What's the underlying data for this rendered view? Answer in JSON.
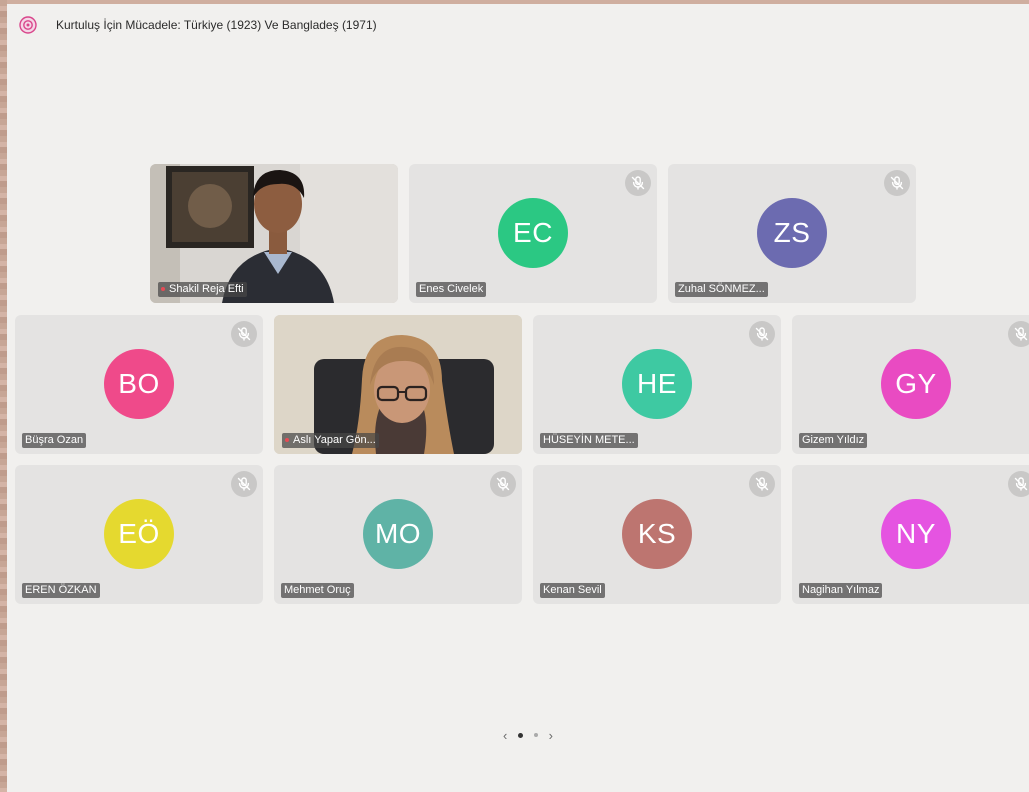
{
  "meeting": {
    "title": "Kurtuluş İçin Mücadele: Türkiye (1923) Ve Bangladeş (1971)",
    "logo_icon": "app-logo-icon"
  },
  "colors": {
    "window_bg": "#f1f0ee",
    "tile_bg": "#e4e3e2",
    "mute_icon": "mic-off-icon"
  },
  "participants": [
    {
      "name": "Shakil Reja Efti",
      "initials": "",
      "video": true,
      "muted": false,
      "color": ""
    },
    {
      "name": "Enes Civelek",
      "initials": "EC",
      "video": false,
      "muted": true,
      "color": "#2bc883"
    },
    {
      "name": "Zuhal SÖNMEZ...",
      "initials": "ZS",
      "video": false,
      "muted": true,
      "color": "#6c6bb0"
    },
    {
      "name": "Büşra Ozan",
      "initials": "BO",
      "video": false,
      "muted": true,
      "color": "#ef4a8a"
    },
    {
      "name": "Aslı Yapar Gön...",
      "initials": "",
      "video": true,
      "muted": false,
      "color": ""
    },
    {
      "name": "HÜSEYİN METE...",
      "initials": "HE",
      "video": false,
      "muted": true,
      "color": "#3ec9a2"
    },
    {
      "name": "Gizem Yıldız",
      "initials": "GY",
      "video": false,
      "muted": true,
      "color": "#e94bc2"
    },
    {
      "name": "EREN ÖZKAN",
      "initials": "EÖ",
      "video": false,
      "muted": true,
      "color": "#e5d92f"
    },
    {
      "name": "Mehmet Oruç",
      "initials": "MO",
      "video": false,
      "muted": true,
      "color": "#5fb3a6"
    },
    {
      "name": "Kenan Sevil",
      "initials": "KS",
      "video": false,
      "muted": true,
      "color": "#bd7570"
    },
    {
      "name": "Nagihan Yılmaz",
      "initials": "NY",
      "video": false,
      "muted": true,
      "color": "#e554e1"
    }
  ],
  "pager": {
    "prev": "‹",
    "next": "›",
    "current_page": 1,
    "total_pages": 2
  }
}
